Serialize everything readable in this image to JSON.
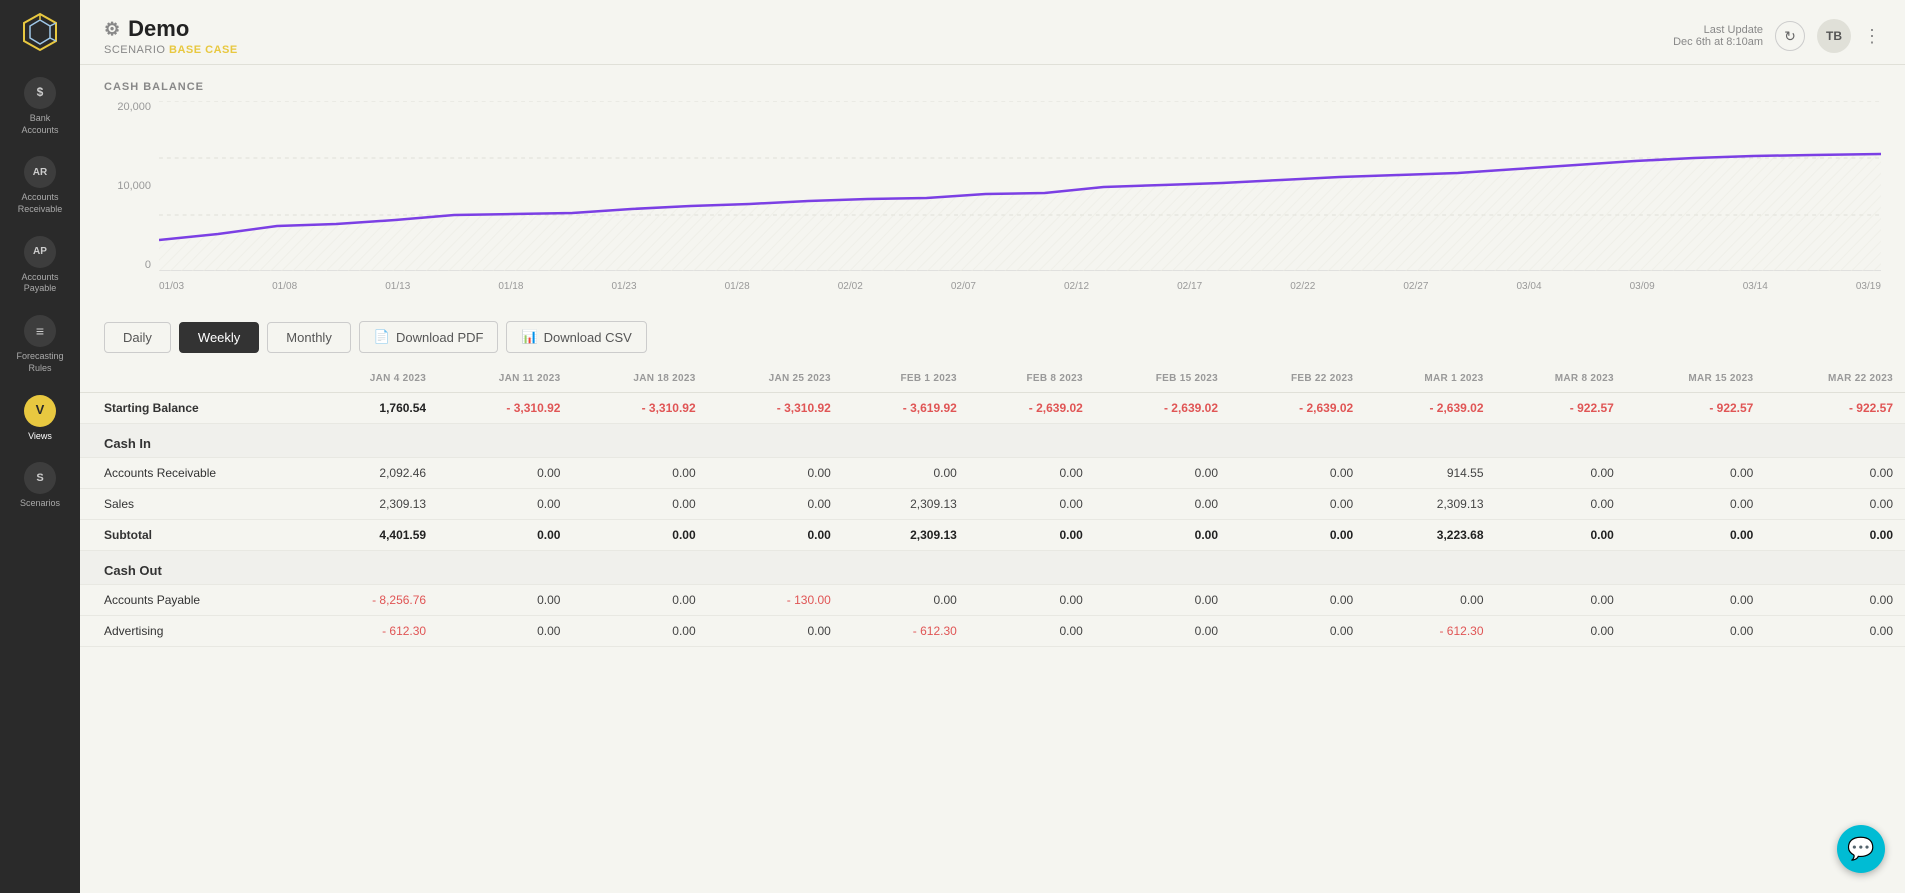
{
  "app": {
    "title": "Demo",
    "scenario_label": "SCENARIO",
    "scenario_value": "BASE CASE",
    "last_update_label": "Last Update",
    "last_update_value": "Dec 6th at 8:10am",
    "avatar_initials": "TB"
  },
  "sidebar": {
    "logo_icon": "cube-icon",
    "items": [
      {
        "id": "bank-accounts",
        "label": "Bank\nAccounts",
        "icon_text": "S",
        "active": false
      },
      {
        "id": "accounts-receivable",
        "label": "Accounts\nReceivable",
        "icon_text": "AR",
        "active": false
      },
      {
        "id": "accounts-payable",
        "label": "Accounts\nPayable",
        "icon_text": "AP",
        "active": false
      },
      {
        "id": "forecasting-rules",
        "label": "Forecasting\nRules",
        "icon_text": "≡",
        "active": false
      },
      {
        "id": "views",
        "label": "Views",
        "icon_text": "V",
        "active": true
      },
      {
        "id": "scenarios",
        "label": "Scenarios",
        "icon_text": "S",
        "active": false
      }
    ]
  },
  "chart": {
    "section_label": "CASH BALANCE",
    "y_labels": [
      "20,000",
      "10,000",
      "0"
    ],
    "x_labels": [
      "01/03",
      "01/08",
      "01/13",
      "01/18",
      "01/23",
      "01/28",
      "02/02",
      "02/07",
      "02/12",
      "02/17",
      "02/22",
      "02/27",
      "03/04",
      "03/09",
      "03/14",
      "03/19"
    ]
  },
  "controls": {
    "daily_label": "Daily",
    "weekly_label": "Weekly",
    "monthly_label": "Monthly",
    "download_pdf_label": "Download PDF",
    "download_csv_label": "Download CSV",
    "pdf_icon": "📄",
    "csv_icon": "📊"
  },
  "table": {
    "columns": [
      "",
      "JAN 4 2023",
      "JAN 11 2023",
      "JAN 18 2023",
      "JAN 25 2023",
      "FEB 1 2023",
      "FEB 8 2023",
      "FEB 15 2023",
      "FEB 22 2023",
      "MAR 1 2023",
      "MAR 8 2023",
      "MAR 15 2023",
      "MAR 22 2023"
    ],
    "rows": [
      {
        "type": "bold",
        "label": "Starting Balance",
        "values": [
          "1,760.54",
          "- 3,310.92",
          "- 3,310.92",
          "- 3,310.92",
          "- 3,619.92",
          "- 2,639.02",
          "- 2,639.02",
          "- 2,639.02",
          "- 922.57",
          "- 922.57",
          "- 922.57"
        ]
      },
      {
        "type": "section",
        "label": "Cash In",
        "values": []
      },
      {
        "type": "normal",
        "label": "Accounts Receivable",
        "values": [
          "2,092.46",
          "0.00",
          "0.00",
          "0.00",
          "0.00",
          "0.00",
          "0.00",
          "0.00",
          "914.55",
          "0.00",
          "0.00",
          "0.00"
        ]
      },
      {
        "type": "normal",
        "label": "Sales",
        "values": [
          "2,309.13",
          "0.00",
          "0.00",
          "0.00",
          "2,309.13",
          "0.00",
          "0.00",
          "0.00",
          "2,309.13",
          "0.00",
          "0.00",
          "0.00"
        ]
      },
      {
        "type": "bold",
        "label": "Subtotal",
        "values": [
          "4,401.59",
          "0.00",
          "0.00",
          "0.00",
          "2,309.13",
          "0.00",
          "0.00",
          "0.00",
          "3,223.68",
          "0.00",
          "0.00",
          "0.00"
        ]
      },
      {
        "type": "section",
        "label": "Cash Out",
        "values": []
      },
      {
        "type": "normal",
        "label": "Accounts Payable",
        "values": [
          "- 8,256.76",
          "0.00",
          "0.00",
          "- 130.00",
          "0.00",
          "0.00",
          "0.00",
          "0.00",
          "0.00",
          "0.00",
          "0.00",
          "0.00"
        ]
      },
      {
        "type": "normal",
        "label": "Advertising",
        "values": [
          "- 612.30",
          "0.00",
          "0.00",
          "0.00",
          "- 612.30",
          "0.00",
          "0.00",
          "0.00",
          "- 612.30",
          "0.00",
          "0.00",
          "0.00"
        ]
      }
    ]
  }
}
